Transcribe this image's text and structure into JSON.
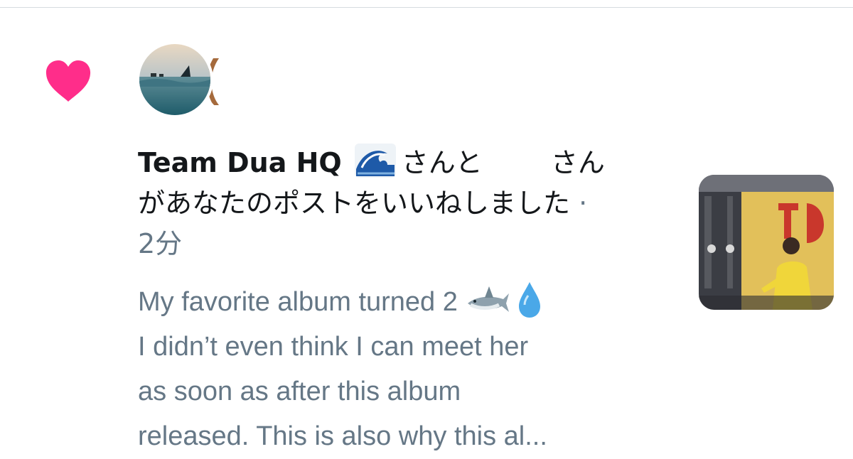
{
  "notification": {
    "type_icon": "heart-icon",
    "accent_color": "#e0245e",
    "avatars": [
      {
        "icon": "avatar-ocean-shark"
      },
      {
        "icon": "avatar-partial"
      }
    ],
    "actor_name": "Team Dua HQ",
    "actor_emoji": "wave-emoji",
    "text_after_name": "さんと",
    "text_second_actor_suffix": "さん",
    "action_text": "があなたのポストをいいねしました",
    "separator": "·",
    "time": "2分",
    "tweet_lines": [
      "My favorite album turned 2",
      "I didn’t even think I can meet her",
      "as soon as after this album",
      "released. This is also why this al..."
    ],
    "tweet_emojis": [
      "shark-emoji",
      "droplet-emoji"
    ],
    "media": {
      "icon": "concert-photo-thumbnail"
    }
  },
  "colors": {
    "primary_text": "#14171a",
    "secondary_text": "#657786",
    "divider": "#d6dbe0",
    "heart": "#ff2d8a"
  }
}
